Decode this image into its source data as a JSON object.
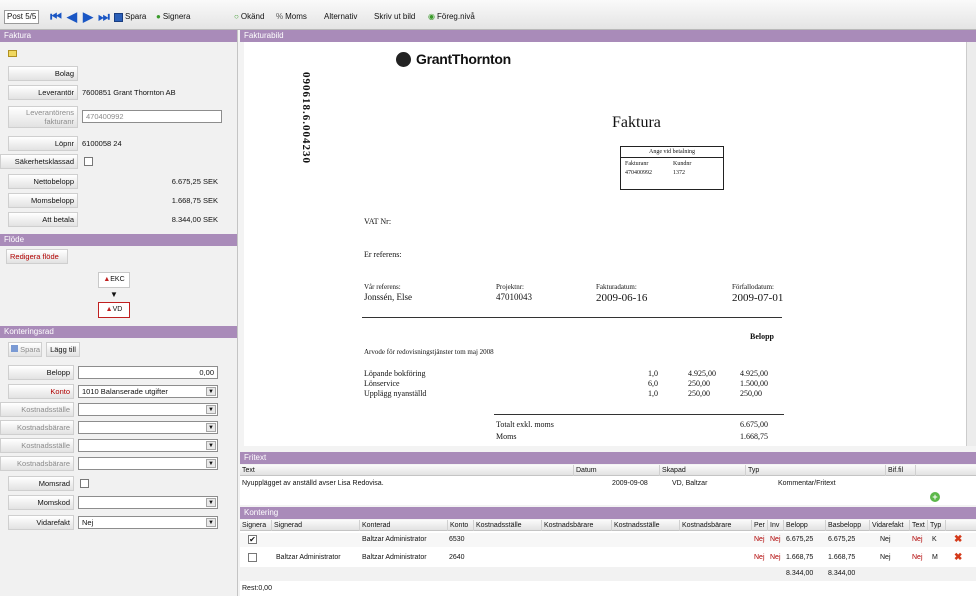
{
  "toolbar": {
    "post": "Post 5/5",
    "save": "Spara",
    "sign": "Signera",
    "unknown": "Okänd",
    "vat": "Moms",
    "alt": "Alternativ",
    "print": "Skriv ut bild",
    "prev_level": "Föreg.nivå"
  },
  "faktura": {
    "section": "Faktura",
    "fields": [
      {
        "label": "Bolag",
        "value": ""
      },
      {
        "label": "Leverantör",
        "value": "7600851 Grant Thornton AB"
      },
      {
        "label": "Leverantörens fakturanr",
        "value": "470400992"
      },
      {
        "label": "Löpnr",
        "value": "6100058 24"
      },
      {
        "label": "Säkerhetsklassad",
        "value": ""
      },
      {
        "label": "Nettobelopp",
        "value": "6.675,25 SEK"
      },
      {
        "label": "Momsbelopp",
        "value": "1.668,75 SEK"
      },
      {
        "label": "Att betala",
        "value": "8.344,00 SEK"
      }
    ]
  },
  "flode": {
    "section": "Flöde",
    "edit": "Redigera flöde",
    "node1": "EKC",
    "node2": "VD"
  },
  "kontering_left": {
    "section": "Konteringsrad",
    "save": "Spara",
    "add": "Lägg till",
    "fields": [
      {
        "label": "Belopp",
        "value": "0,00"
      },
      {
        "label": "Konto",
        "value": "1010 Balanserade utgifter"
      },
      {
        "label": "Kostnadsställe",
        "value": ""
      },
      {
        "label": "Kostnadsbärare",
        "value": ""
      },
      {
        "label": "Kostnadsställe",
        "value": ""
      },
      {
        "label": "Kostnadsbärare",
        "value": ""
      },
      {
        "label": "Momsrad",
        "value": ""
      },
      {
        "label": "Momskod",
        "value": ""
      },
      {
        "label": "Vidarefakt",
        "value": "Nej"
      }
    ]
  },
  "invoice": {
    "section": "Fakturabild",
    "brand": "GrantThornton",
    "side_number": "090618.6.004230",
    "title": "Faktura",
    "box_header": "Ange vid betalning",
    "box_k1": "Fakturanr",
    "box_k2": "Kundnr",
    "box_v1": "470400992",
    "box_v2": "1372",
    "vat": "VAT Nr:",
    "your_ref": "Er referens:",
    "our_ref_label": "Vår referens:",
    "our_ref": "Jonssén, Else",
    "project_label": "Projektnr:",
    "project": "47010043",
    "invdate_label": "Fakturadatum:",
    "invdate": "2009-06-16",
    "duedate_label": "Förfallodatum:",
    "duedate": "2009-07-01",
    "amount_label": "Belopp",
    "desc": "Arvode för redovisningstjänster tom maj 2008",
    "lines": [
      {
        "name": "Löpande bokföring",
        "qty": "1,0",
        "price": "4.925,00",
        "amount": "4.925,00"
      },
      {
        "name": "Lönservice",
        "qty": "6,0",
        "price": "250,00",
        "amount": "1.500,00"
      },
      {
        "name": "Upplägg nyanställd",
        "qty": "1,0",
        "price": "250,00",
        "amount": "250,00"
      }
    ],
    "total_excl_label": "Totalt exkl. moms",
    "total_excl": "6.675,00",
    "moms_label": "Moms",
    "moms": "1.668,75"
  },
  "fritext": {
    "section": "Fritext",
    "headers": [
      "Text",
      "Datum",
      "Skapad",
      "Typ",
      "Bif.fil"
    ],
    "row": [
      "Nyupplägget av anställd avser Lisa Redovisa.",
      "2009-09-08",
      "VD, Baltzar",
      "Kommentar/Fritext",
      ""
    ]
  },
  "kontering": {
    "section": "Kontering",
    "headers": [
      "Signera",
      "Signerad",
      "Konterad",
      "Konto",
      "Kostnadsställe",
      "Kostnadsbärare",
      "Kostnadsställe",
      "Kostnadsbärare",
      "Per",
      "Inv",
      "Belopp",
      "Basbelopp",
      "Vidarefakt",
      "Text",
      "Typ"
    ],
    "rows": [
      {
        "signed": "",
        "konterad": "Baltzar Administrator",
        "konto": "6530",
        "per": "Nej",
        "inv": "Nej",
        "belopp": "6.675,25",
        "bas": "6.675,25",
        "vidare": "Nej",
        "text": "Nej",
        "typ": "K"
      },
      {
        "signed": "Baltzar Administrator",
        "konterad": "Baltzar Administrator",
        "konto": "2640",
        "per": "Nej",
        "inv": "Nej",
        "belopp": "1.668,75",
        "bas": "1.668,75",
        "vidare": "Nej",
        "text": "Nej",
        "typ": "M"
      }
    ],
    "sum_belopp": "8.344,00",
    "sum_bas": "8.344,00",
    "rest": "Rest:0,00"
  },
  "colors": {
    "section_bar": "#a98bb9",
    "nav_blue": "#1a56c4",
    "delete_red": "#d43a1a"
  }
}
